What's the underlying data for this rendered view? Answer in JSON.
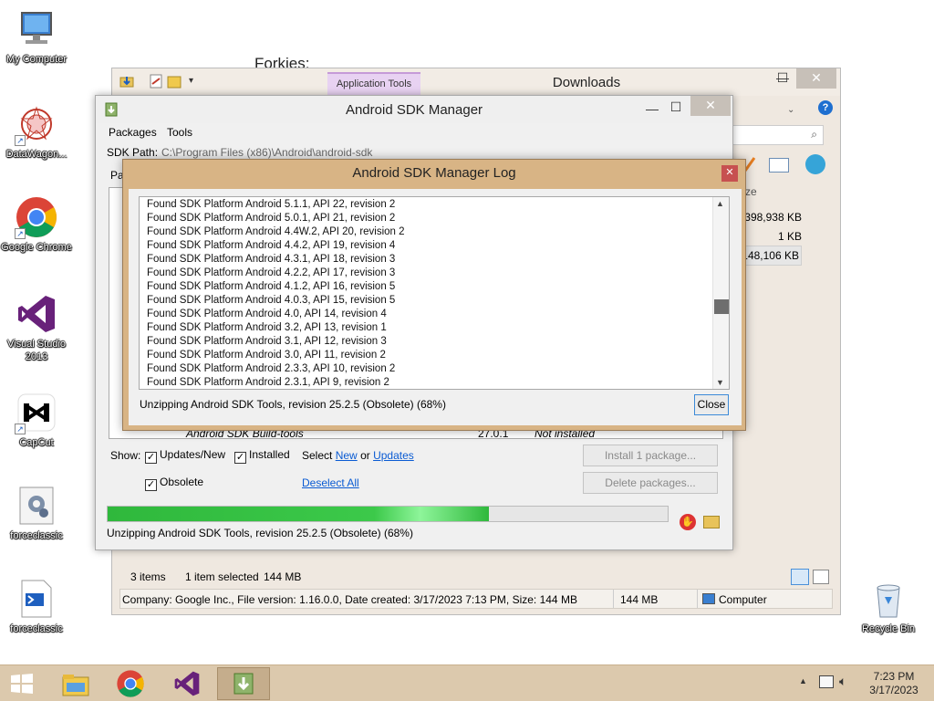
{
  "desktop": {
    "icons": [
      {
        "label": "My Computer"
      },
      {
        "label": "DataWagon..."
      },
      {
        "label": "Google Chrome"
      },
      {
        "label": "Visual Studio 2013"
      },
      {
        "label": "CapCut"
      },
      {
        "label": "forceclassic"
      },
      {
        "label": "forceclassic"
      },
      {
        "label": "Recycle Bin"
      }
    ],
    "background_text": "Forkies:"
  },
  "explorer": {
    "ribbon_tab": "Application Tools",
    "title": "Downloads",
    "search_placeholder": "s",
    "column_header": "ze",
    "sizes": [
      "398,938 KB",
      "1 KB",
      "148,106 KB"
    ],
    "status": {
      "items": "3 items",
      "selected": "1 item selected",
      "size": "144 MB"
    },
    "details_bar": {
      "info": "Company: Google Inc., File version: 1.16.0.0, Date created: 3/17/2023 7:13 PM, Size: 144 MB",
      "size": "144 MB",
      "location": "Computer"
    }
  },
  "sdk_manager": {
    "title": "Android SDK Manager",
    "menu": [
      "Packages",
      "Tools"
    ],
    "sdk_path_label": "SDK Path:",
    "sdk_path_value": "C:\\Program Files (x86)\\Android\\android-sdk",
    "partial_label": "Pa",
    "hidden_row": {
      "name": "Android SDK Build-tools",
      "rev": "27.0.1",
      "status": "Not installed"
    },
    "show_label": "Show:",
    "filters": [
      {
        "label": "Updates/New",
        "checked": true
      },
      {
        "label": "Installed",
        "checked": true
      },
      {
        "label": "Obsolete",
        "checked": true
      }
    ],
    "select_label": "Select",
    "select_new": "New",
    "or_label": "or",
    "select_updates": "Updates",
    "deselect_all": "Deselect All",
    "install_button": "Install 1 package...",
    "delete_button": "Delete packages...",
    "progress": 0.68,
    "status_text": "Unzipping Android SDK Tools, revision 25.2.5 (Obsolete) (68%)"
  },
  "log_dialog": {
    "title": "Android SDK Manager Log",
    "lines": [
      "Found SDK Platform Android 5.1.1, API 22, revision 2",
      "Found SDK Platform Android 5.0.1, API 21, revision 2",
      "Found SDK Platform Android 4.4W.2, API 20, revision 2",
      "Found SDK Platform Android 4.4.2, API 19, revision 4",
      "Found SDK Platform Android 4.3.1, API 18, revision 3",
      "Found SDK Platform Android 4.2.2, API 17, revision 3",
      "Found SDK Platform Android 4.1.2, API 16, revision 5",
      "Found SDK Platform Android 4.0.3, API 15, revision 5",
      "Found SDK Platform Android 4.0, API 14, revision 4",
      "Found SDK Platform Android 3.2, API 13, revision 1",
      "Found SDK Platform Android 3.1, API 12, revision 3",
      "Found SDK Platform Android 3.0, API 11, revision 2",
      "Found SDK Platform Android 2.3.3, API 10, revision 2",
      "Found SDK Platform Android 2.3.1, API 9, revision 2"
    ],
    "status_text": "Unzipping Android SDK Tools, revision 25.2.5 (Obsolete) (68%)",
    "close_button": "Close"
  },
  "taskbar": {
    "time": "7:23 PM",
    "date": "3/17/2023"
  },
  "colors": {
    "taskbar": "#dcc9ad",
    "log_frame": "#d8b485",
    "progress": "#2fb83c",
    "link": "#0a5bd3"
  }
}
